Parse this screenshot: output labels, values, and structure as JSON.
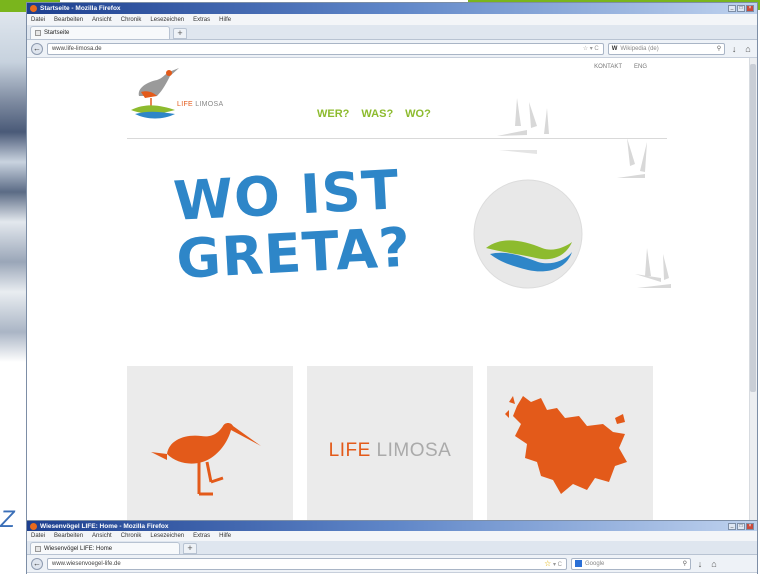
{
  "window1": {
    "title": "Startseite - Mozilla Firefox",
    "menu": [
      "Datei",
      "Bearbeiten",
      "Ansicht",
      "Chronik",
      "Lesezeichen",
      "Extras",
      "Hilfe"
    ],
    "tab_label": "Startseite",
    "url": "www.life-limosa.de",
    "search_engine": "W",
    "search_placeholder": "Wikipedia (de)"
  },
  "site": {
    "logo_life": "LIFE",
    "logo_limosa": "LIMOSA",
    "topnav": [
      "KONTAKT",
      "ENG"
    ],
    "mainnav": [
      "WER?",
      "WAS?",
      "WO?"
    ],
    "headline_line1": "WO IST",
    "headline_line2": "GRETA?",
    "card2_life": "LIFE",
    "card2_limosa": "LIMOSA"
  },
  "window2": {
    "title": "Wiesenvögel LIFE: Home - Mozilla Firefox",
    "menu": [
      "Datei",
      "Bearbeiten",
      "Ansicht",
      "Chronik",
      "Lesezeichen",
      "Extras",
      "Hilfe"
    ],
    "tab_label": "Wiesenvögel LIFE: Home",
    "url": "www.wiesenvoegel-life.de",
    "search_placeholder": "Google"
  },
  "colors": {
    "brand_blue": "#2e86c8",
    "brand_orange": "#e35a1a",
    "brand_green": "#8dbb2e",
    "slide_green": "#7ab51d"
  }
}
